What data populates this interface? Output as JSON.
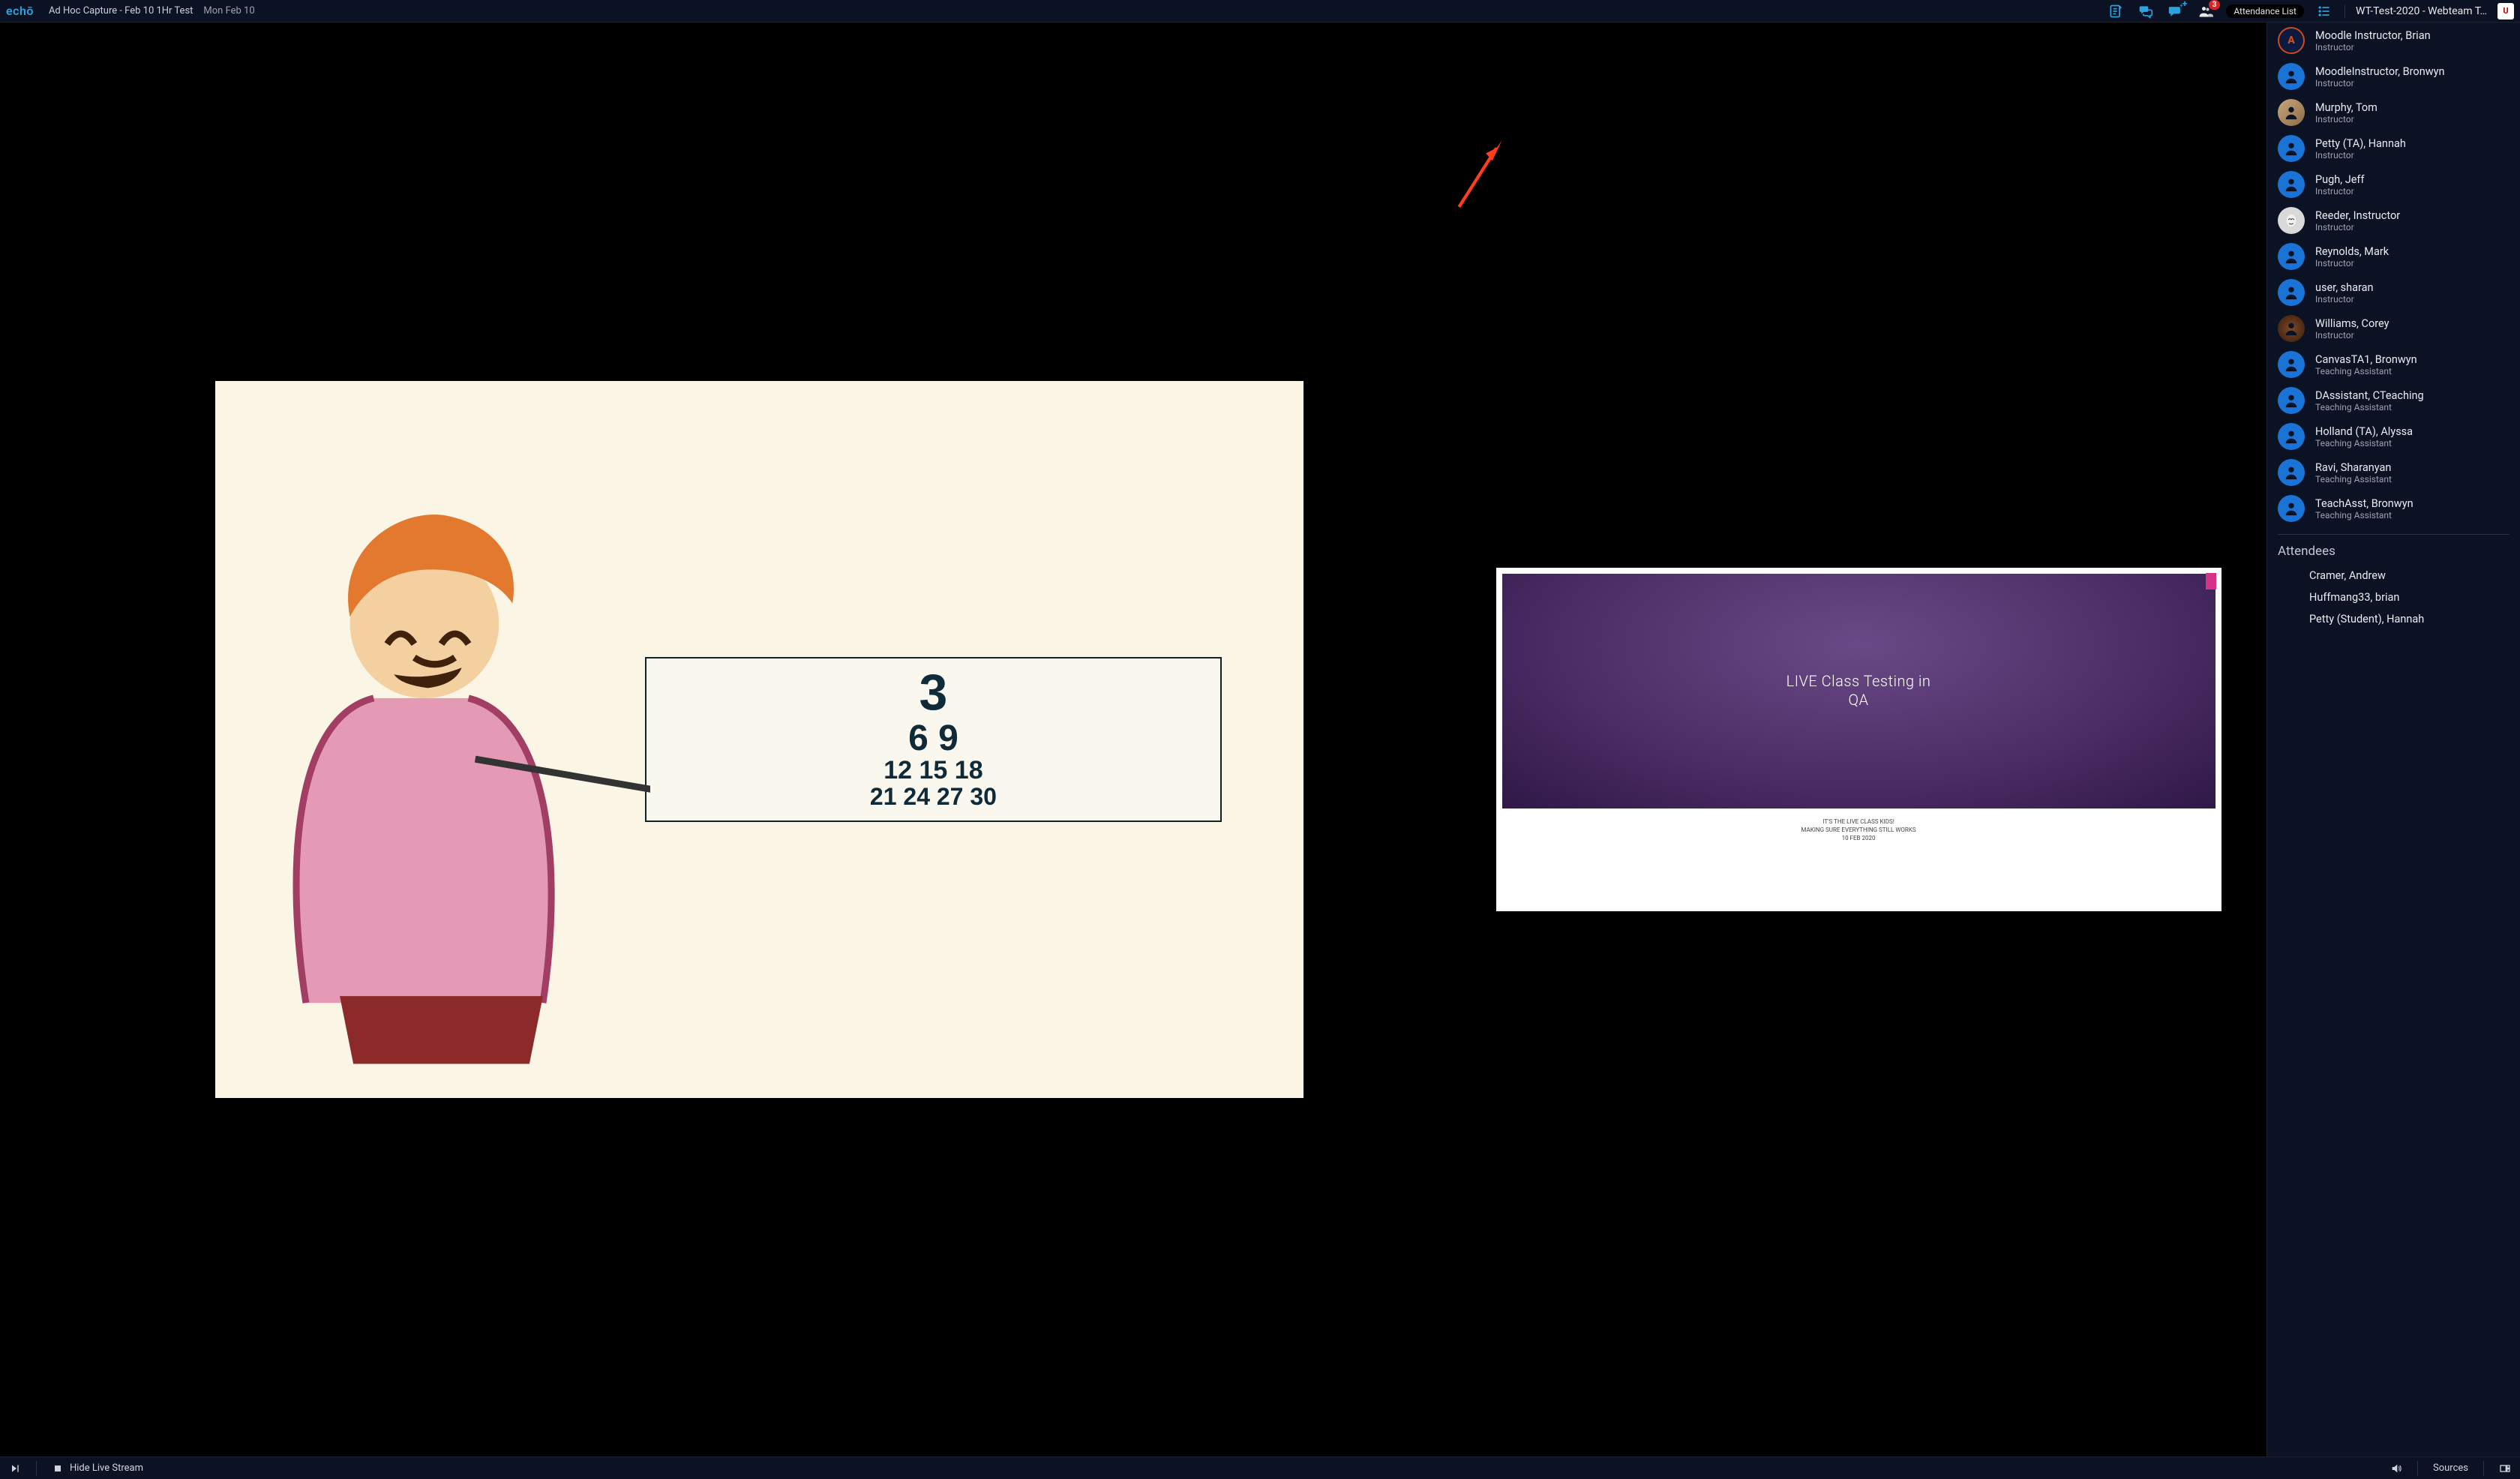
{
  "header": {
    "logo": "echō",
    "title": "Ad Hoc Capture - Feb 10 1Hr Test",
    "date": "Mon Feb 10",
    "badge_count": "3",
    "attendance_pill": "Attendance List",
    "course_title": "WT-Test-2020 - Webteam T…",
    "uni_badge": "U"
  },
  "video": {
    "board": {
      "r1": "3",
      "r2": "6 9",
      "r3": "12 15 18",
      "r4": "21 24 27 30"
    },
    "slide": {
      "title_line1": "LIVE Class Testing in",
      "title_line2": "QA",
      "sub1": "IT'S THE LIVE CLASS KIDS!",
      "sub2": "MAKING SURE EVERYTHING STILL WORKS",
      "sub3": "10 FEB 2020"
    }
  },
  "sidebar": {
    "people": [
      {
        "name": "Moodle Instructor, Brian",
        "role": "Instructor",
        "avatar": "au"
      },
      {
        "name": "MoodleInstructor, Bronwyn",
        "role": "Instructor",
        "avatar": "default"
      },
      {
        "name": "Murphy, Tom",
        "role": "Instructor",
        "avatar": "tom"
      },
      {
        "name": "Petty (TA), Hannah",
        "role": "Instructor",
        "avatar": "default"
      },
      {
        "name": "Pugh, Jeff",
        "role": "Instructor",
        "avatar": "default"
      },
      {
        "name": "Reeder, Instructor",
        "role": "Instructor",
        "avatar": "mask"
      },
      {
        "name": "Reynolds, Mark",
        "role": "Instructor",
        "avatar": "default"
      },
      {
        "name": "user, sharan",
        "role": "Instructor",
        "avatar": "default"
      },
      {
        "name": "Williams, Corey",
        "role": "Instructor",
        "avatar": "corey"
      },
      {
        "name": "CanvasTA1, Bronwyn",
        "role": "Teaching Assistant",
        "avatar": "default"
      },
      {
        "name": "DAssistant, CTeaching",
        "role": "Teaching Assistant",
        "avatar": "default"
      },
      {
        "name": "Holland (TA), Alyssa",
        "role": "Teaching Assistant",
        "avatar": "default"
      },
      {
        "name": "Ravi, Sharanyan",
        "role": "Teaching Assistant",
        "avatar": "default"
      },
      {
        "name": "TeachAsst, Bronwyn",
        "role": "Teaching Assistant",
        "avatar": "default"
      }
    ],
    "attendees_header": "Attendees",
    "attendees": [
      "Cramer, Andrew",
      "Huffmang33, brian",
      "Petty (Student), Hannah"
    ]
  },
  "bottom": {
    "hide_label": "Hide Live Stream",
    "sources_label": "Sources"
  }
}
